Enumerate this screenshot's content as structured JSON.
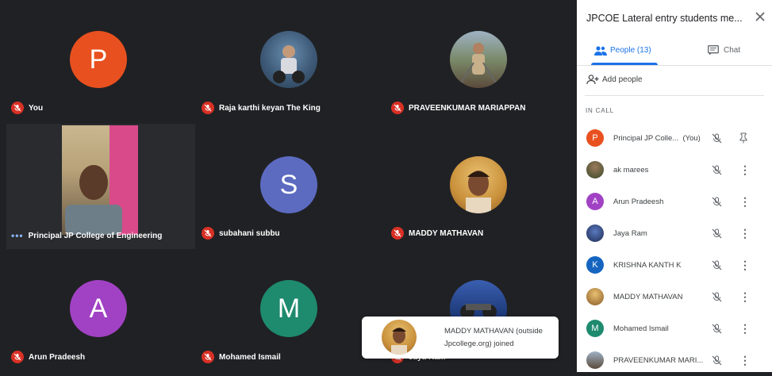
{
  "tiles": [
    {
      "name": "You",
      "initial": "P",
      "color": "#e8511f"
    },
    {
      "name": "Raja karthi keyan The King"
    },
    {
      "name": "PRAVEENKUMAR MARIAPPAN"
    },
    {
      "name": "Principal JP College of Engineering"
    },
    {
      "name": "subahani subbu",
      "initial": "S",
      "color": "#5c6bc0"
    },
    {
      "name": "MADDY MATHAVAN"
    },
    {
      "name": "Arun Pradeesh",
      "initial": "A",
      "color": "#a142c4"
    },
    {
      "name": "Mohamed Ismail",
      "initial": "M",
      "color": "#1e8a6e"
    },
    {
      "name": "Jaya Ram"
    }
  ],
  "toast": {
    "line1": "MADDY MATHAVAN (outside",
    "line2": "Jpcollege.org) joined"
  },
  "panel": {
    "title": "JPCOE Lateral entry students me...",
    "tab_people": "People (13)",
    "tab_chat": "Chat",
    "add_people": "Add people",
    "in_call": "IN CALL",
    "people": [
      {
        "name": "Principal JP Colle...",
        "suffix": "(You)",
        "initial": "P",
        "color": "#e8511f",
        "action": "pin"
      },
      {
        "name": "ak marees",
        "photo": true,
        "action": "more"
      },
      {
        "name": "Arun Pradeesh",
        "initial": "A",
        "color": "#a142c4",
        "action": "more"
      },
      {
        "name": "Jaya Ram",
        "photo": true,
        "action": "more"
      },
      {
        "name": "KRISHNA KANTH K",
        "initial": "K",
        "color": "#1565c0",
        "action": "more"
      },
      {
        "name": "MADDY MATHAVAN",
        "photo": true,
        "action": "more"
      },
      {
        "name": "Mohamed Ismail",
        "initial": "M",
        "color": "#1e8a6e",
        "action": "more"
      },
      {
        "name": "PRAVEENKUMAR MARI...",
        "photo": true,
        "action": "more"
      }
    ]
  }
}
